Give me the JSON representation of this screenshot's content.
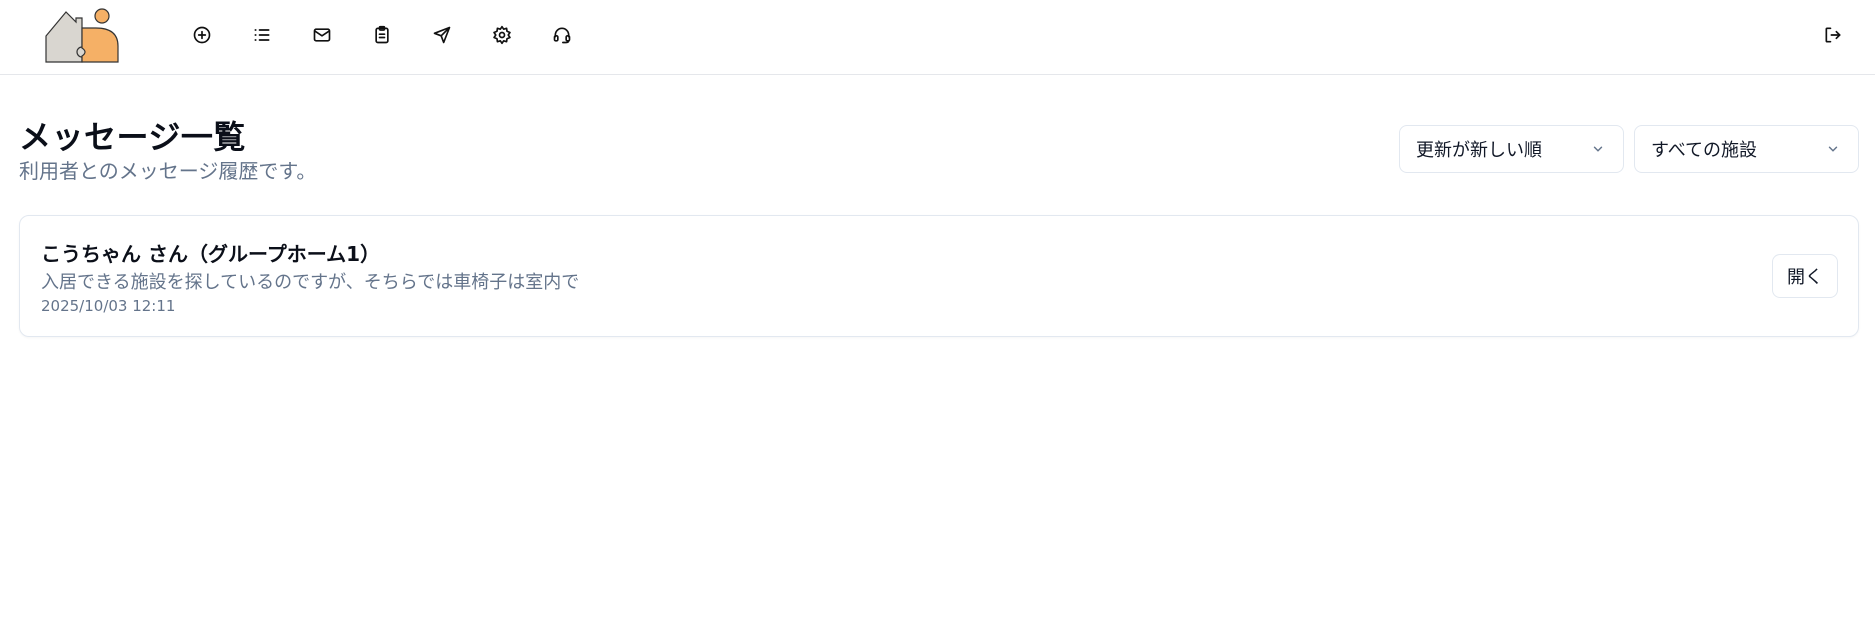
{
  "header": {
    "logo_icon": "house-person-puzzle-logo",
    "nav": [
      {
        "name": "add-icon"
      },
      {
        "name": "list-icon"
      },
      {
        "name": "mail-icon"
      },
      {
        "name": "clipboard-icon"
      },
      {
        "name": "send-icon"
      },
      {
        "name": "gear-icon"
      },
      {
        "name": "headset-icon"
      }
    ],
    "logout_icon": "logout-icon"
  },
  "page": {
    "title": "メッセージ一覧",
    "subtitle": "利用者とのメッセージ履歴です。"
  },
  "filters": {
    "sort_selected": "更新が新しい順",
    "facility_selected": "すべての施設"
  },
  "messages": [
    {
      "name": "こうちゃん さん（グループホーム1）",
      "preview": "入居できる施設を探しているのですが、そちらでは車椅子は室内で",
      "timestamp": "2025/10/03 12:11",
      "open_label": "開く"
    }
  ],
  "colors": {
    "logo_orange": "#f5b066",
    "logo_gray": "#d9d6d0",
    "muted_text": "#64748b",
    "border": "#e2e8f0"
  }
}
